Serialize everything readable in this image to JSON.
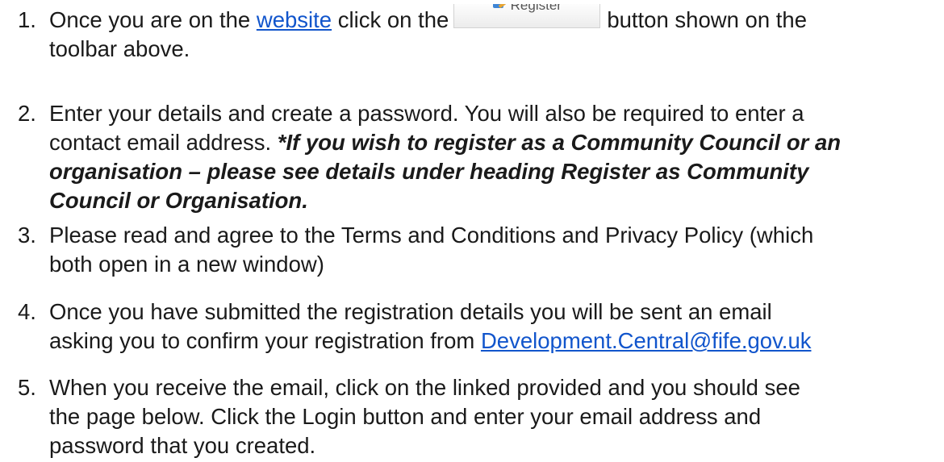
{
  "steps": [
    {
      "number": "1.",
      "pre": "Once you are on the ",
      "link": "website",
      "mid": " click on the",
      "button_label": "Register",
      "post": "button shown on the",
      "line2": "toolbar above."
    },
    {
      "number": "2.",
      "line1": "Enter your details and create a password. You will also be required to enter a",
      "line2_plain": "contact email address. ",
      "line2_emph": "*If you wish to register as a Community Council or an",
      "line3_emph": "organisation – please see details under heading Register as Community",
      "line4_emph": "Council or Organisation."
    },
    {
      "number": "3.",
      "line1": "Please read and agree to the Terms and Conditions and Privacy Policy (which",
      "line2": "both open in a new window)"
    },
    {
      "number": "4.",
      "line1": "Once you have submitted the registration details you will be sent an email",
      "line2_pre": "asking you to confirm your registration from ",
      "email_link": "Development.Central@fife.gov.uk"
    },
    {
      "number": "5.",
      "line1": "When you receive the email, click on the linked provided and you should see",
      "line2": "the page below. Click the Login button and enter your email address and",
      "line3": "password that you created."
    }
  ],
  "colors": {
    "link": "#1155cc",
    "text": "#1a1a1a"
  },
  "icons": {
    "register_button_icon": "register-icon"
  }
}
